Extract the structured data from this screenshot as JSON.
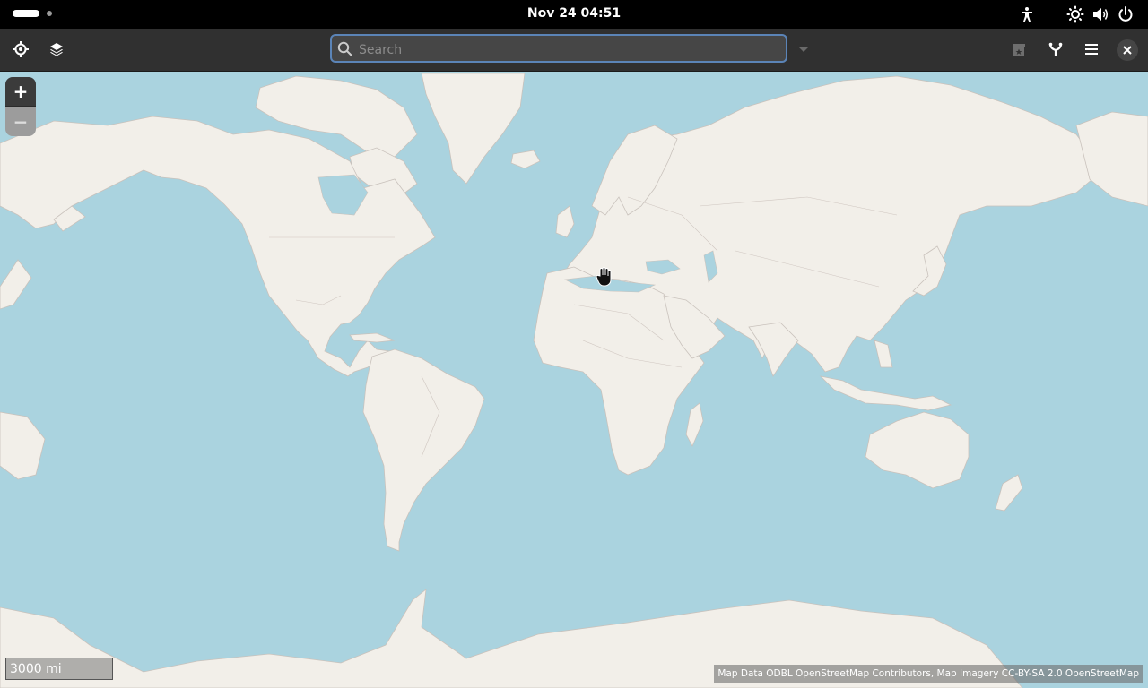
{
  "top_bar": {
    "clock": "Nov 24  04:51",
    "icons": [
      "activities-pill",
      "accessibility-icon",
      "brightness-icon",
      "volume-icon",
      "power-icon"
    ]
  },
  "header": {
    "search": {
      "placeholder": "Search",
      "value": ""
    },
    "left_buttons": [
      "locate-icon",
      "layers-icon"
    ],
    "right_buttons": [
      "favorites-icon",
      "route-icon",
      "menu-icon",
      "close-icon"
    ],
    "accent": "#5b84b7"
  },
  "map": {
    "zoom_in_label": "+",
    "zoom_out_label": "−",
    "scale_label": "3000 mi",
    "attribution": "Map Data ODBL OpenStreetMap Contributors, Map Imagery CC-BY-SA 2.0 OpenStreetMap",
    "colors": {
      "water": "#aad3df",
      "land": "#f2efe9",
      "border": "#c9c2bc"
    }
  }
}
